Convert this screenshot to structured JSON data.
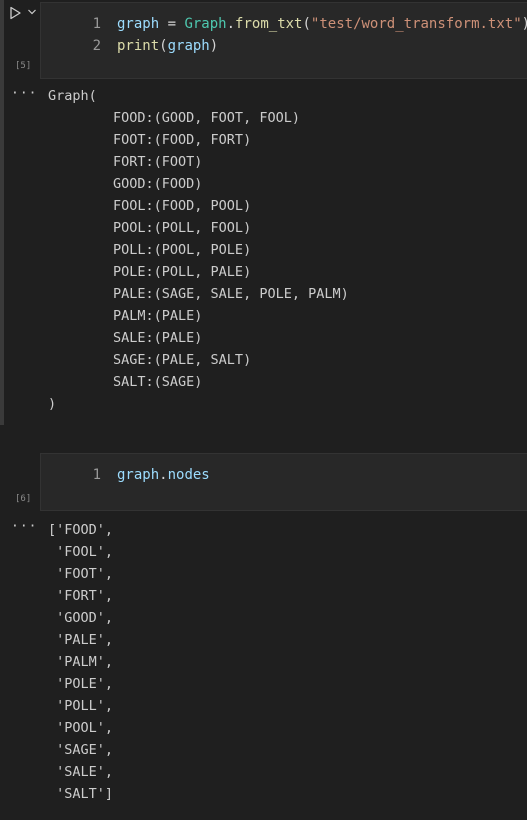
{
  "cell1": {
    "exec_count": "[5]",
    "lines": [
      {
        "num": "1",
        "tokens": [
          {
            "t": "graph",
            "c": "tk-var"
          },
          {
            "t": " = ",
            "c": "tk-op"
          },
          {
            "t": "Graph",
            "c": "tk-cls"
          },
          {
            "t": ".",
            "c": "tk-op"
          },
          {
            "t": "from_txt",
            "c": "tk-fn"
          },
          {
            "t": "(",
            "c": "tk-op"
          },
          {
            "t": "\"test/word_transform.txt\"",
            "c": "tk-str"
          },
          {
            "t": ")",
            "c": "tk-op"
          }
        ]
      },
      {
        "num": "2",
        "tokens": [
          {
            "t": "print",
            "c": "tk-fn"
          },
          {
            "t": "(",
            "c": "tk-op"
          },
          {
            "t": "graph",
            "c": "tk-var"
          },
          {
            "t": ")",
            "c": "tk-op"
          }
        ]
      }
    ],
    "output_more": "···",
    "output": [
      "Graph(",
      "        FOOD:(GOOD, FOOT, FOOL)",
      "        FOOT:(FOOD, FORT)",
      "        FORT:(FOOT)",
      "        GOOD:(FOOD)",
      "        FOOL:(FOOD, POOL)",
      "        POOL:(POLL, FOOL)",
      "        POLL:(POOL, POLE)",
      "        POLE:(POLL, PALE)",
      "        PALE:(SAGE, SALE, POLE, PALM)",
      "        PALM:(PALE)",
      "        SALE:(PALE)",
      "        SAGE:(PALE, SALT)",
      "        SALT:(SAGE)",
      ")"
    ]
  },
  "cell2": {
    "exec_count": "[6]",
    "lines": [
      {
        "num": "1",
        "tokens": [
          {
            "t": "graph",
            "c": "tk-var"
          },
          {
            "t": ".",
            "c": "tk-op"
          },
          {
            "t": "nodes",
            "c": "tk-var"
          }
        ]
      }
    ],
    "output_more": "···",
    "output": [
      "['FOOD',",
      " 'FOOL',",
      " 'FOOT',",
      " 'FORT',",
      " 'GOOD',",
      " 'PALE',",
      " 'PALM',",
      " 'POLE',",
      " 'POLL',",
      " 'POOL',",
      " 'SAGE',",
      " 'SALE',",
      " 'SALT']"
    ]
  }
}
